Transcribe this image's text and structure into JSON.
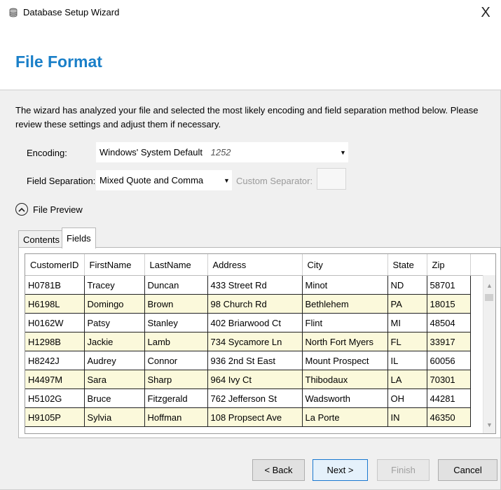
{
  "window": {
    "title": "Database Setup Wizard",
    "close_glyph": "X"
  },
  "header": {
    "title": "File Format"
  },
  "description": "The wizard has analyzed your file and selected the most likely encoding and field separation method below.  Please review these settings and adjust them if necessary.",
  "encoding": {
    "label": "Encoding:",
    "value": "Windows' System Default",
    "code": "1252"
  },
  "field_separation": {
    "label": "Field Separation:",
    "value": "Mixed Quote and Comma",
    "custom_label": "Custom Separator:",
    "custom_value": ""
  },
  "preview": {
    "label": "File Preview",
    "expanded": true
  },
  "tabs": [
    {
      "label": "Contents",
      "selected": false
    },
    {
      "label": "Fields",
      "selected": true
    }
  ],
  "table": {
    "columns": [
      "CustomerID",
      "FirstName",
      "LastName",
      "Address",
      "City",
      "State",
      "Zip"
    ],
    "rows": [
      [
        "H0781B",
        "Tracey",
        "Duncan",
        "433 Street Rd",
        "Minot",
        "ND",
        "58701"
      ],
      [
        "H6198L",
        "Domingo",
        "Brown",
        "98 Church Rd",
        "Bethlehem",
        "PA",
        "18015"
      ],
      [
        "H0162W",
        "Patsy",
        "Stanley",
        "402 Briarwood Ct",
        "Flint",
        "MI",
        "48504"
      ],
      [
        "H1298B",
        "Jackie",
        "Lamb",
        "734 Sycamore Ln",
        "North Fort Myers",
        "FL",
        "33917"
      ],
      [
        "H8242J",
        "Audrey",
        "Connor",
        "936 2nd St East",
        "Mount Prospect",
        "IL",
        "60056"
      ],
      [
        "H4497M",
        "Sara",
        "Sharp",
        "964 Ivy Ct",
        "Thibodaux",
        "LA",
        "70301"
      ],
      [
        "H5102G",
        "Bruce",
        "Fitzgerald",
        "762 Jefferson St",
        "Wadsworth",
        "OH",
        "44281"
      ],
      [
        "H9105P",
        "Sylvia",
        "Hoffman",
        "108 Propsect Ave",
        "La Porte",
        "IN",
        "46350"
      ]
    ]
  },
  "buttons": {
    "back": "< Back",
    "next": "Next >",
    "finish": "Finish",
    "cancel": "Cancel"
  },
  "colors": {
    "accent": "#1a7fc8",
    "alt_row": "#fbf9db"
  }
}
